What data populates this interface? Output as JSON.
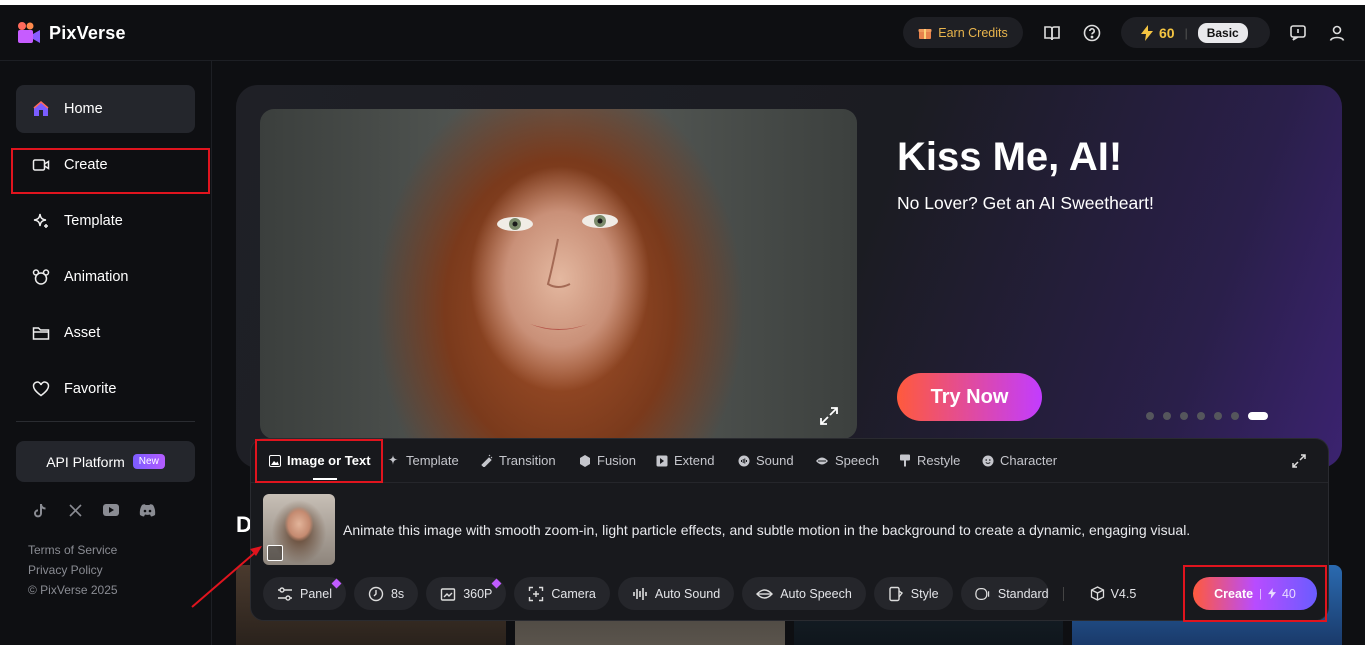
{
  "app": {
    "name": "PixVerse"
  },
  "header": {
    "earn_credits": "Earn Credits",
    "credits": "60",
    "plan": "Basic"
  },
  "sidebar": {
    "items": [
      {
        "label": "Home",
        "icon": "home-icon"
      },
      {
        "label": "Create",
        "icon": "video-camera-icon"
      },
      {
        "label": "Template",
        "icon": "sparkle-icon"
      },
      {
        "label": "Animation",
        "icon": "animation-icon"
      },
      {
        "label": "Asset",
        "icon": "folder-icon"
      },
      {
        "label": "Favorite",
        "icon": "heart-icon"
      }
    ],
    "api_platform": "API Platform",
    "new_badge": "New",
    "footer": {
      "terms": "Terms of Service",
      "privacy": "Privacy Policy",
      "copyright": "© PixVerse 2025"
    }
  },
  "hero": {
    "title": "Kiss Me, AI!",
    "subtitle": "No Lover? Get an AI Sweetheart!",
    "cta": "Try Now"
  },
  "section_peek": "D",
  "panel": {
    "tabs": [
      {
        "label": "Image or Text",
        "icon": "image-icon"
      },
      {
        "label": "Template",
        "icon": "sparkle-icon"
      },
      {
        "label": "Transition",
        "icon": "transition-icon"
      },
      {
        "label": "Fusion",
        "icon": "fusion-icon"
      },
      {
        "label": "Extend",
        "icon": "extend-icon"
      },
      {
        "label": "Sound",
        "icon": "sound-icon"
      },
      {
        "label": "Speech",
        "icon": "speech-icon"
      },
      {
        "label": "Restyle",
        "icon": "restyle-icon"
      },
      {
        "label": "Character",
        "icon": "character-icon"
      }
    ],
    "prompt": "Animate this image with smooth zoom-in, light particle effects, and subtle motion in the background to create a dynamic, engaging visual.",
    "options": {
      "panel": "Panel",
      "duration": "8s",
      "resolution": "360P",
      "camera": "Camera",
      "auto_sound": "Auto Sound",
      "auto_speech": "Auto Speech",
      "style": "Style",
      "quality": "Standard",
      "version": "V4.5"
    },
    "create_label": "Create",
    "create_cost": "40"
  },
  "colors": {
    "accent_gold": "#f5c542",
    "highlight_red": "#e0141e",
    "gradient_start": "#ff5a3c",
    "gradient_end": "#6a5cff"
  }
}
